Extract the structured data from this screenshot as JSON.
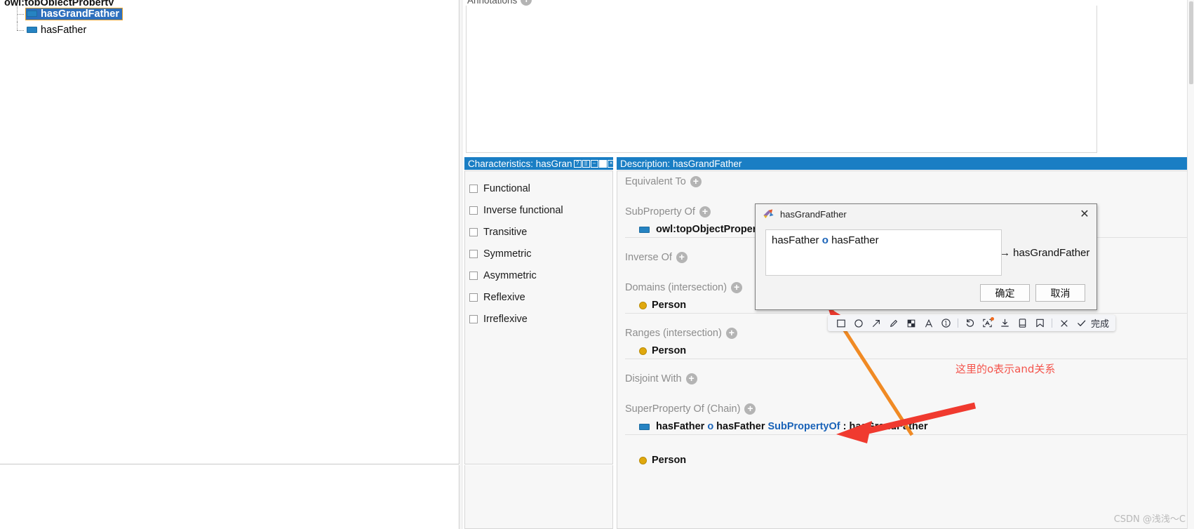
{
  "tree": {
    "root_label": "owl:topObjectProperty",
    "items": [
      {
        "label": "hasGrandFather",
        "selected": true
      },
      {
        "label": "hasFather",
        "selected": false
      }
    ]
  },
  "annotations_panel": {
    "title": "Annotations",
    "add_icon": "plus-circle-icon"
  },
  "characteristics_panel": {
    "title": "Characteristics: hasGran",
    "window_buttons": [
      "?",
      "|",
      "–",
      "■",
      "×"
    ],
    "items": [
      {
        "label": "Functional",
        "checked": false
      },
      {
        "label": "Inverse functional",
        "checked": false
      },
      {
        "label": "Transitive",
        "checked": false
      },
      {
        "label": "Symmetric",
        "checked": false
      },
      {
        "label": "Asymmetric",
        "checked": false
      },
      {
        "label": "Reflexive",
        "checked": false
      },
      {
        "label": "Irreflexive",
        "checked": false
      }
    ]
  },
  "description_panel": {
    "title": "Description: hasGrandFather",
    "sections": [
      {
        "heading": "Equivalent To",
        "items": []
      },
      {
        "heading": "SubProperty Of",
        "items": [
          {
            "icon": "object-property-icon",
            "text": "owl:topObjectProperty"
          }
        ]
      },
      {
        "heading": "Inverse Of",
        "items": []
      },
      {
        "heading": "Domains (intersection)",
        "items": [
          {
            "icon": "class-dot-icon",
            "text": "Person"
          }
        ]
      },
      {
        "heading": "Ranges (intersection)",
        "items": [
          {
            "icon": "class-dot-icon",
            "text": "Person"
          }
        ]
      },
      {
        "heading": "Disjoint With",
        "items": []
      },
      {
        "heading": "SuperProperty Of (Chain)",
        "items": [
          {
            "icon": "object-property-icon",
            "prefix": "hasFather",
            "operator": "o",
            "middle": "hasFather",
            "keyword": "SubPropertyOf",
            "suffix": ": hasGrandFather"
          }
        ]
      },
      {
        "heading": "",
        "items": [
          {
            "icon": "class-dot-icon",
            "text": "Person"
          }
        ]
      }
    ]
  },
  "dialog": {
    "icon": "protege-icon",
    "title": "hasGrandFather",
    "close_icon": "close-icon",
    "expression": {
      "left": "hasFather",
      "operator": "o",
      "right": "hasFather"
    },
    "result_text": "→ hasGrandFather",
    "ok_label": "确定",
    "cancel_label": "取消"
  },
  "screenshot_toolbar": {
    "tools": [
      {
        "name": "rectangle-icon"
      },
      {
        "name": "ellipse-icon"
      },
      {
        "name": "arrow-icon"
      },
      {
        "name": "pencil-icon"
      },
      {
        "name": "mosaic-icon"
      },
      {
        "name": "text-icon"
      },
      {
        "name": "numbered-marker-icon"
      },
      {
        "name": "undo-icon"
      },
      {
        "name": "ocr-extract-icon"
      },
      {
        "name": "download-icon"
      },
      {
        "name": "pin-to-screen-icon"
      },
      {
        "name": "save-note-icon"
      },
      {
        "name": "cancel-icon"
      },
      {
        "name": "confirm-check-icon"
      }
    ],
    "done_label": "完成"
  },
  "annotation_overlay": {
    "note_text": "这里的o表示and关系",
    "note_color": "#f4544c",
    "orange_line_color": "#f08a24",
    "red_arrow_color": "#f03a2f"
  },
  "watermark": {
    "text": "CSDN @浅浅～C"
  }
}
